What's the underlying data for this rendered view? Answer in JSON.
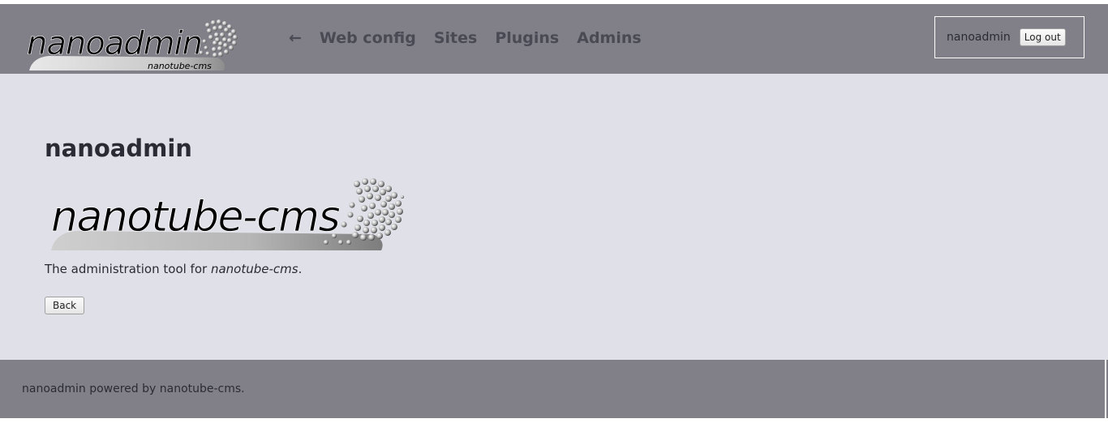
{
  "header": {
    "logo_text": "nanoadmin",
    "logo_subtext": "nanotube-cms",
    "nav": {
      "back_arrow": "←",
      "items": [
        "Web config",
        "Sites",
        "Plugins",
        "Admins"
      ]
    },
    "user": {
      "name": "nanoadmin",
      "logout_label": "Log out"
    }
  },
  "main": {
    "title": "nanoadmin",
    "cms_logo_text": "nanotube-cms",
    "intro_prefix": "The administration tool for ",
    "intro_em": "nanotube-cms",
    "intro_suffix": ".",
    "back_label": "Back"
  },
  "footer": {
    "text": "nanoadmin powered by nanotube-cms."
  },
  "colors": {
    "header_bg": "#818089",
    "main_bg": "#e0e0e8",
    "text": "#2b2b35",
    "nav_text": "#4a4a55"
  }
}
